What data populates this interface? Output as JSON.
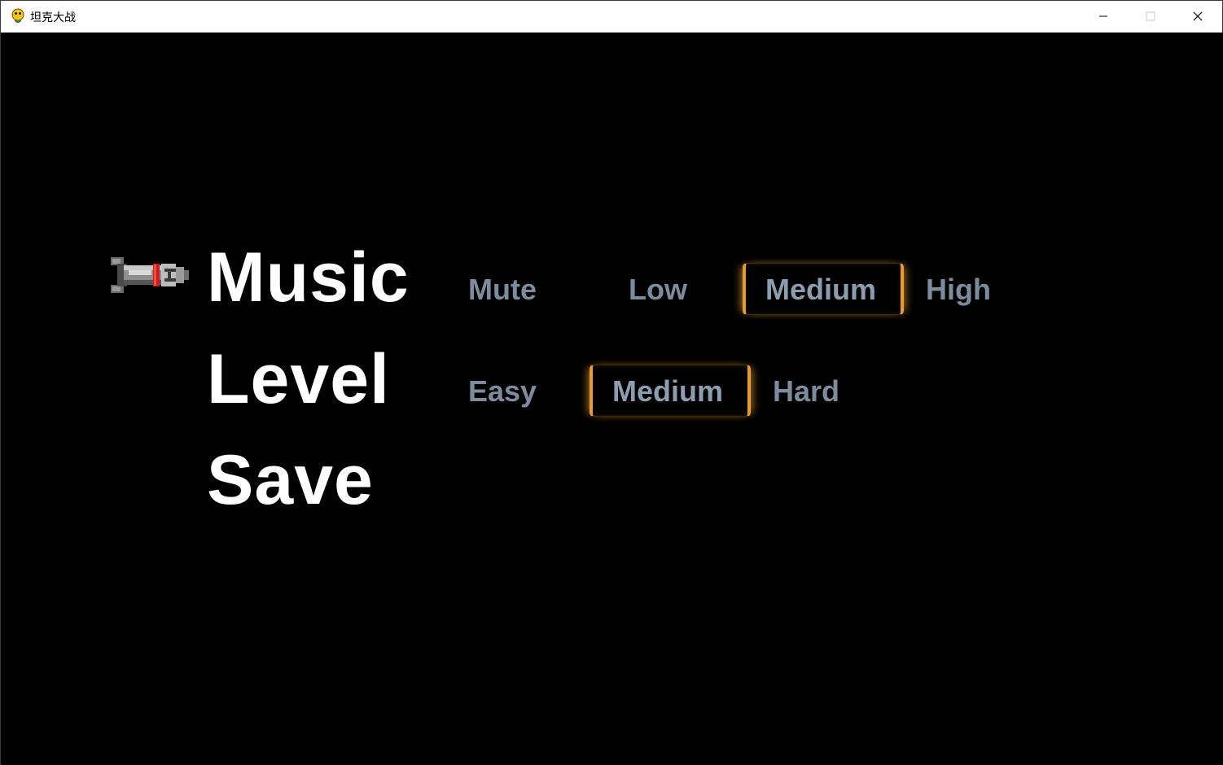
{
  "window": {
    "title": "坦克大战",
    "icon": "python-snake-icon",
    "controls": [
      "minimize-icon",
      "maximize-icon",
      "close-icon"
    ]
  },
  "menu": {
    "cursor_icon": "bullet-icon",
    "selected_row": "music",
    "rows": {
      "music": {
        "label": "Music",
        "options": [
          "Mute",
          "Low",
          "Medium",
          "High"
        ],
        "selected": "Medium"
      },
      "level": {
        "label": "Level",
        "options": [
          "Easy",
          "Medium",
          "Hard"
        ],
        "selected": "Medium"
      },
      "save": {
        "label": "Save"
      }
    }
  },
  "colors": {
    "background": "#000000",
    "label": "#ffffff",
    "option": "#7c8c9c",
    "selection_accent": "#e59a3a"
  }
}
